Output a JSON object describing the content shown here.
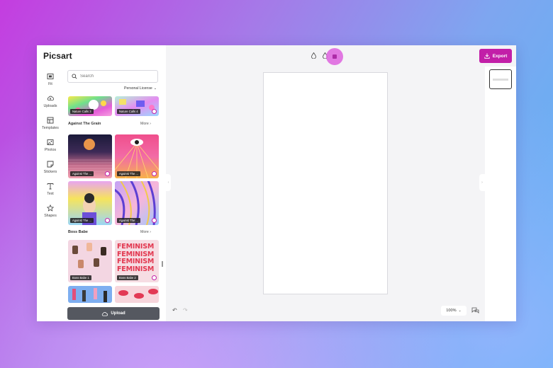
{
  "app": {
    "logo": "Picsart"
  },
  "toolbar": {
    "export_label": "Export"
  },
  "rail": {
    "items": [
      {
        "label": "Fit",
        "icon": "fit-icon"
      },
      {
        "label": "Uploads",
        "icon": "upload-cloud-icon"
      },
      {
        "label": "Templates",
        "icon": "templates-icon"
      },
      {
        "label": "Photos",
        "icon": "photos-icon"
      },
      {
        "label": "Stickers",
        "icon": "stickers-icon"
      },
      {
        "label": "Text",
        "icon": "text-icon"
      },
      {
        "label": "Shapes",
        "icon": "shapes-icon"
      }
    ]
  },
  "panel": {
    "search_placeholder": "Search",
    "license_filter": "Personal License",
    "top_thumbs": [
      {
        "label": "Nature Calls 3"
      },
      {
        "label": "Nature Calls 4"
      }
    ],
    "sections": [
      {
        "title": "Against The Grain",
        "more": "More",
        "thumbs": [
          {
            "label": "Against The ..."
          },
          {
            "label": "Against The ..."
          },
          {
            "label": "Against The ..."
          },
          {
            "label": "Against The ..."
          }
        ]
      },
      {
        "title": "Boss Babe",
        "more": "More",
        "thumbs": [
          {
            "label": "Boss Babe 1"
          },
          {
            "label": "Boss Babe 2"
          }
        ]
      }
    ],
    "feminism_text": "FEMINISM",
    "upload_label": "Upload"
  },
  "footer": {
    "zoom": "100%"
  },
  "colors": {
    "accent": "#c21fa8",
    "highlight": "#e06be0",
    "upload_button": "#555860"
  }
}
